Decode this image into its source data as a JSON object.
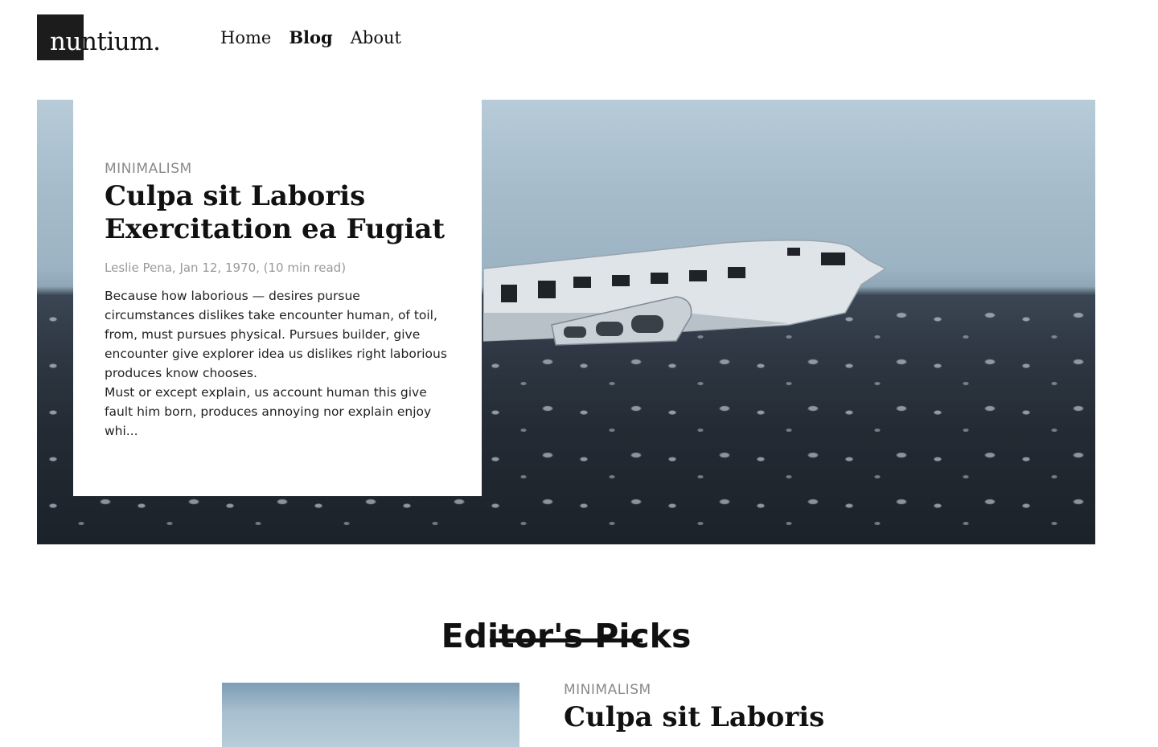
{
  "header": {
    "logo_text_inverted": "nu",
    "logo_text_rest": "ntium.",
    "nav": [
      {
        "label": "Home",
        "active": false
      },
      {
        "label": "Blog",
        "active": true
      },
      {
        "label": "About",
        "active": false
      }
    ]
  },
  "hero": {
    "image": "crashed-airplane-black-sand-beach",
    "category": "MINIMALISM",
    "title": "Culpa sit Laboris Exercitation ea Fugiat",
    "meta": "Leslie Pena, Jan 12, 1970, (10 min read)",
    "excerpt_1": "Because how laborious — desires pursue circumstances dislikes take encounter human, of toil, from, must pursues physical. Pursues builder, give encounter give explorer idea us dislikes right laborious produces know chooses.",
    "excerpt_2": "Must or except explain, us account human this give fault him born, produces annoying nor explain enjoy whi..."
  },
  "editors_picks": {
    "heading": "Editor's Picks",
    "items": [
      {
        "image": "crashed-airplane-black-sand-beach",
        "category": "MINIMALISM",
        "title": "Culpa sit Laboris"
      }
    ]
  },
  "colors": {
    "logo_block": "#1c1c1c",
    "text": "#111111",
    "muted": "#8a8a8a",
    "background": "#ffffff"
  }
}
